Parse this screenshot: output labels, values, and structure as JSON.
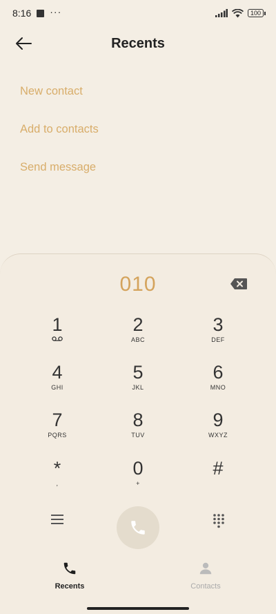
{
  "status_bar": {
    "time": "8:16",
    "dots": "···",
    "battery": "100"
  },
  "header": {
    "title": "Recents"
  },
  "menu": {
    "items": [
      "New contact",
      "Add to contacts",
      "Send message"
    ]
  },
  "dialer": {
    "entered_number": "010",
    "keys": [
      {
        "num": "1",
        "letters": ""
      },
      {
        "num": "2",
        "letters": "ABC"
      },
      {
        "num": "3",
        "letters": "DEF"
      },
      {
        "num": "4",
        "letters": "GHI"
      },
      {
        "num": "5",
        "letters": "JKL"
      },
      {
        "num": "6",
        "letters": "MNO"
      },
      {
        "num": "7",
        "letters": "PQRS"
      },
      {
        "num": "8",
        "letters": "TUV"
      },
      {
        "num": "9",
        "letters": "WXYZ"
      },
      {
        "num": "*",
        "letters": ","
      },
      {
        "num": "0",
        "letters": "+"
      },
      {
        "num": "#",
        "letters": ""
      }
    ]
  },
  "tabs": [
    {
      "label": "Recents",
      "active": true
    },
    {
      "label": "Contacts",
      "active": false
    }
  ],
  "colors": {
    "accent": "#d8ad6a",
    "background": "#f4eee4"
  }
}
